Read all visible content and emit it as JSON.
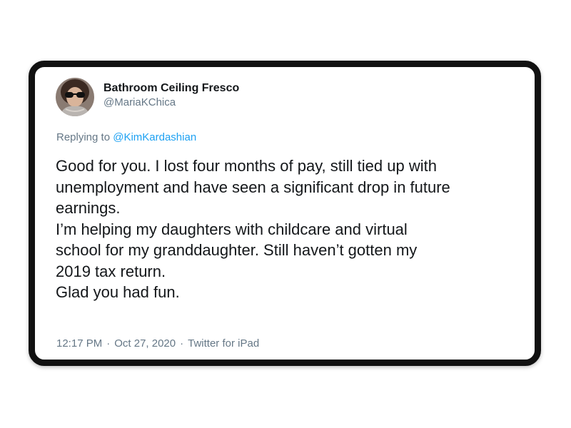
{
  "tweet": {
    "author": {
      "display_name": "Bathroom Ceiling Fresco",
      "handle": "@MariaKChica"
    },
    "replying_prefix": "Replying to",
    "replying_to": "@KimKardashian",
    "paragraphs": [
      "Good for you. I lost four months of pay, still tied up with\nunemployment and have seen a significant drop in future\nearnings.",
      "I’m helping my daughters with childcare and virtual\nschool for my granddaughter. Still haven’t gotten my\n2019 tax return.",
      "Glad you had fun."
    ],
    "time": "12:17 PM",
    "date": "Oct 27, 2020",
    "source": "Twitter for iPad",
    "separator": "·"
  },
  "colors": {
    "text": "#14171a",
    "secondary": "#657786",
    "link": "#1da1f2",
    "border": "#111111"
  }
}
